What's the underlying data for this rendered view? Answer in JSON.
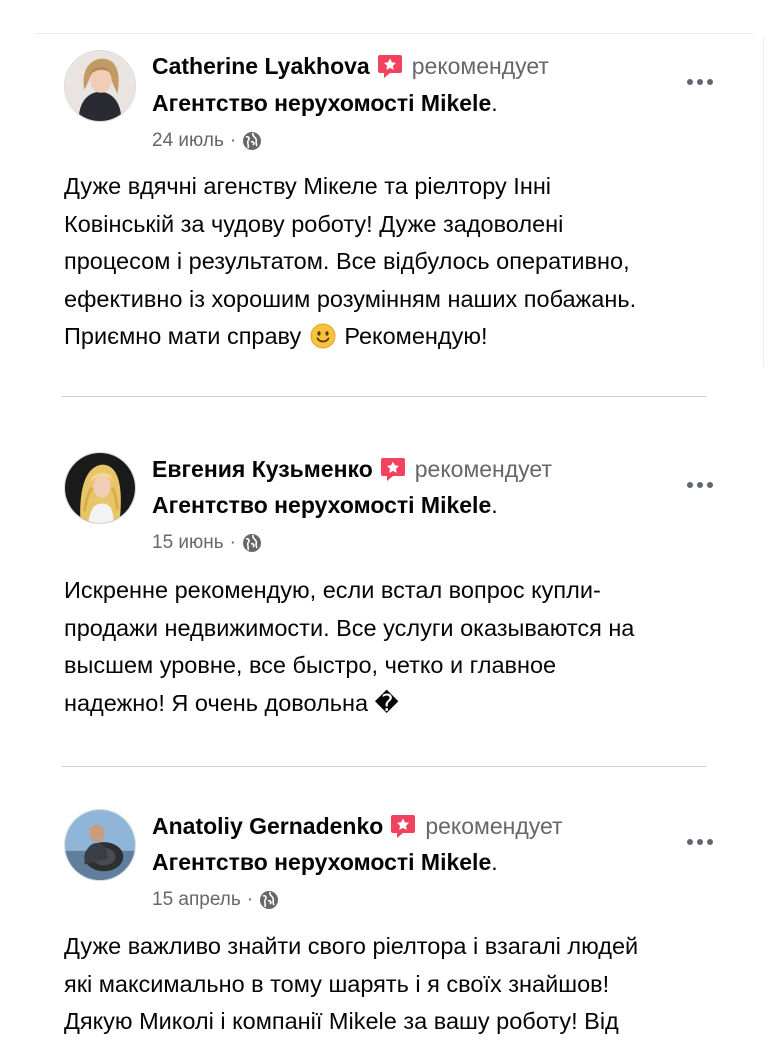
{
  "posts": [
    {
      "author": "Catherine Lyakhova",
      "verb": "рекомендует",
      "page_name": "Агентство нерухомості Mikele",
      "page_suffix": ".",
      "date": "24 июль",
      "separator": "·",
      "privacy_icon": "globe-icon",
      "text_before_emoji": "Дуже вдячні агенству Мікеле та ріелтору Інні\nКовінській за чудову роботу! Дуже задоволені\nпроцесом і результатом. Все відбулось оперативно,\nефективно із хорошим розумінням наших побажань.\nПриємно мати справу ",
      "emoji": "smiling-face-emoji",
      "text_after_emoji": "  Рекомендую!"
    },
    {
      "author": "Евгения Кузьменко",
      "verb": "рекомендует",
      "page_name": "Агентство нерухомості Mikele",
      "page_suffix": ".",
      "date": "15 июнь",
      "separator": "·",
      "privacy_icon": "globe-icon",
      "text": "Искренне рекомендую, если встал вопрос купли-\nпродажи недвижимости. Все услуги оказываются на\nвысшем уровне, все быстро, четко и главное\nнадежно! Я очень довольна �"
    },
    {
      "author": "Anatoliy Gernadenko",
      "verb": "рекомендует",
      "page_name": "Агентство нерухомості Mikele",
      "page_suffix": ".",
      "date": "15 апрель",
      "separator": "·",
      "privacy_icon": "globe-icon",
      "text": "Дуже важливо знайти свого ріелтора і взагалі людей\nякі максимально в тому шарять і я своїх знайшов!\nДякую Миколі і компанії Mikele за вашу роботу! Від"
    }
  ],
  "colors": {
    "recommend_badge": "#f3425f",
    "secondary_text": "#65676b",
    "divider": "#ced0d4",
    "primary_text": "#050505"
  }
}
